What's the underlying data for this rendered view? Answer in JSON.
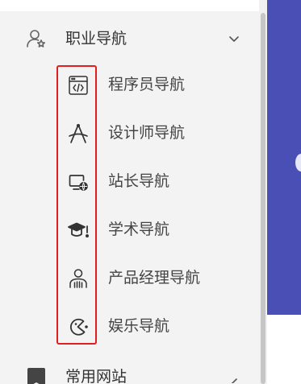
{
  "sidebar": {
    "groups": [
      {
        "label": "职业导航",
        "icon": "user-star-icon",
        "arrow": "chevron-down-icon",
        "expanded": true
      },
      {
        "label": "常用网站",
        "icon": "bookmark-icon",
        "arrow": "chevron-right-icon",
        "expanded": false
      }
    ],
    "items": [
      {
        "label": "程序员导航",
        "icon": "code-window-icon"
      },
      {
        "label": "设计师导航",
        "icon": "compass-tool-icon"
      },
      {
        "label": "站长导航",
        "icon": "monitor-globe-icon"
      },
      {
        "label": "学术导航",
        "icon": "graduation-cap-icon"
      },
      {
        "label": "产品经理导航",
        "icon": "person-chart-icon"
      },
      {
        "label": "娱乐导航",
        "icon": "pacman-icon"
      }
    ]
  },
  "colors": {
    "banner": "#4a4fb6",
    "highlight": "#e02020",
    "sidebar_bg": "#f3f3f3",
    "text": "#444444"
  }
}
